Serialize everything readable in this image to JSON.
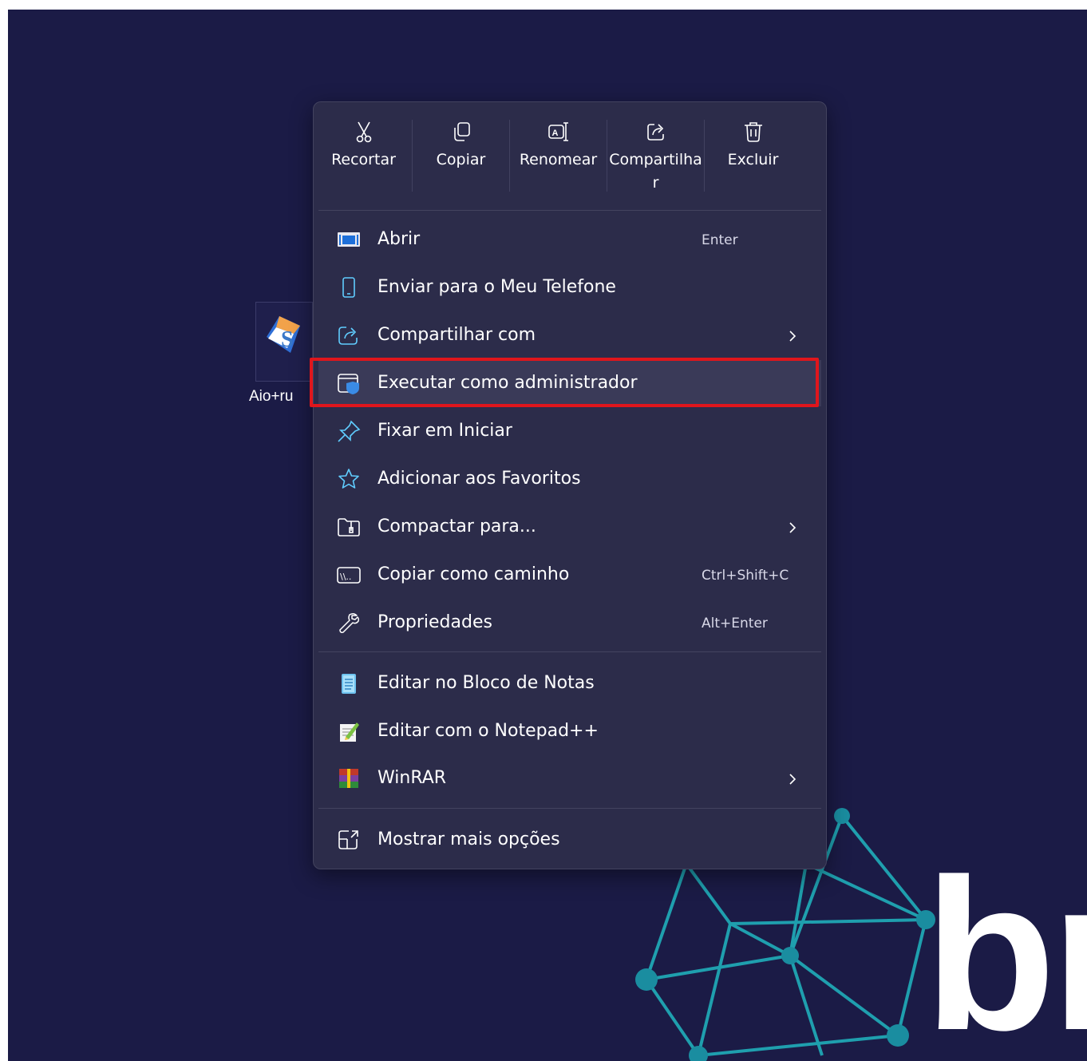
{
  "desktop": {
    "background_color": "#1b1b46",
    "icon_label": "Aio+ru",
    "brand_text": "br"
  },
  "quick_actions": [
    {
      "label": "Recortar",
      "icon": "scissors-icon"
    },
    {
      "label": "Copiar",
      "icon": "copy-icon"
    },
    {
      "label": "Renomear",
      "icon": "rename-icon"
    },
    {
      "label": "Compartilhar",
      "icon": "share-icon"
    },
    {
      "label": "Excluir",
      "icon": "trash-icon"
    }
  ],
  "menu_items": [
    {
      "label": "Abrir",
      "shortcut": "Enter",
      "icon": "app-window-icon"
    },
    {
      "label": "Enviar para o Meu Telefone",
      "icon": "phone-icon"
    },
    {
      "label": "Compartilhar com",
      "icon": "share-icon",
      "submenu": true
    },
    {
      "label": "Executar como administrador",
      "icon": "admin-shield-icon",
      "highlighted": true
    },
    {
      "label": "Fixar em Iniciar",
      "icon": "pin-icon"
    },
    {
      "label": "Adicionar aos Favoritos",
      "icon": "star-icon"
    },
    {
      "label": "Compactar para...",
      "icon": "zip-folder-icon",
      "submenu": true
    },
    {
      "label": "Copiar como caminho",
      "shortcut": "Ctrl+Shift+C",
      "icon": "path-icon"
    },
    {
      "label": "Propriedades",
      "shortcut": "Alt+Enter",
      "icon": "wrench-icon"
    },
    {
      "label": "Editar no Bloco de Notas",
      "icon": "notepad-icon"
    },
    {
      "label": "Editar com o Notepad++",
      "icon": "notepadpp-icon"
    },
    {
      "label": "WinRAR",
      "icon": "winrar-icon",
      "submenu": true
    },
    {
      "label": "Mostrar mais opções",
      "icon": "more-options-icon"
    }
  ],
  "colors": {
    "menu_background": "#2c2c4a",
    "accent_icon": "#60cdff",
    "highlight_border": "#e0161c"
  }
}
